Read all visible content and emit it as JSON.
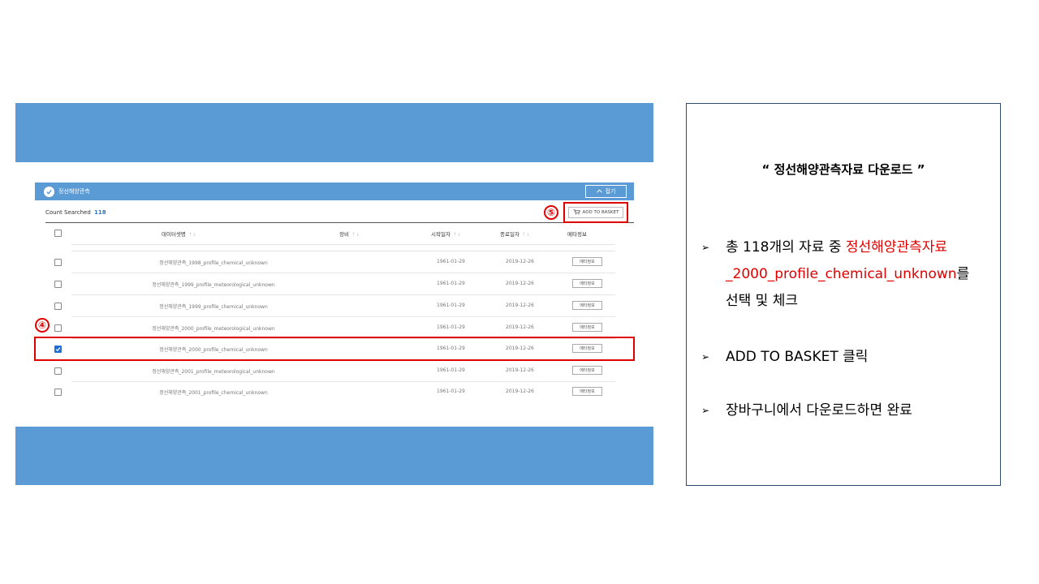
{
  "screenshot": {
    "title": "정선해양관측",
    "fold_label": "접기",
    "count_label": "Count Searched",
    "count_value": "118",
    "basket_label": "ADD TO BASKET",
    "columns": {
      "name": "데이터셋명",
      "equipment": "장비",
      "start": "시작일자",
      "end": "종료일자",
      "meta": "메타정보"
    },
    "sort_glyph": "↑↓",
    "rows": [
      {
        "name": "정선해양관측_1998_profile_chemical_unknown",
        "start": "1961-01-29",
        "end": "2019-12-26",
        "meta": "메타정보",
        "checked": false
      },
      {
        "name": "정선해양관측_1999_profile_meteorological_unknown",
        "start": "1961-01-29",
        "end": "2019-12-26",
        "meta": "메타정보",
        "checked": false
      },
      {
        "name": "정선해양관측_1999_profile_chemical_unknown",
        "start": "1961-01-29",
        "end": "2019-12-26",
        "meta": "메타정보",
        "checked": false
      },
      {
        "name": "정선해양관측_2000_profile_meteorological_unknown",
        "start": "1961-01-29",
        "end": "2019-12-26",
        "meta": "메타정보",
        "checked": false
      },
      {
        "name": "정선해양관측_2000_profile_chemical_unknown",
        "start": "1961-01-29",
        "end": "2019-12-26",
        "meta": "메타정보",
        "checked": true
      },
      {
        "name": "정선해양관측_2001_profile_meteorological_unknown",
        "start": "1961-01-29",
        "end": "2019-12-26",
        "meta": "메타정보",
        "checked": false
      },
      {
        "name": "정선해양관측_2001_profile_chemical_unknown",
        "start": "1961-01-29",
        "end": "2019-12-26",
        "meta": "메타정보",
        "checked": false
      }
    ]
  },
  "annotations": {
    "step4": "④",
    "step5": "⑤",
    "highlight_color": "#e00000"
  },
  "panel": {
    "title": "“  정선해양관측자료 다운로드 ”",
    "bullet_mark": "➢",
    "bullet1_pre": "총 118개의 자료 중 ",
    "bullet1_red1": "정선해양관측자료",
    "bullet1_red2": "_2000_profile_chemical_unknown",
    "bullet1_post1": "를",
    "bullet1_post2": "선택 및 체크",
    "bullet2": "ADD TO BASKET 클릭",
    "bullet3": "장바구니에서 다운로드하면 완료"
  },
  "colors": {
    "band": "#5b9bd5",
    "accent_red": "#e00000",
    "checkbox_blue": "#1f6fd6"
  }
}
